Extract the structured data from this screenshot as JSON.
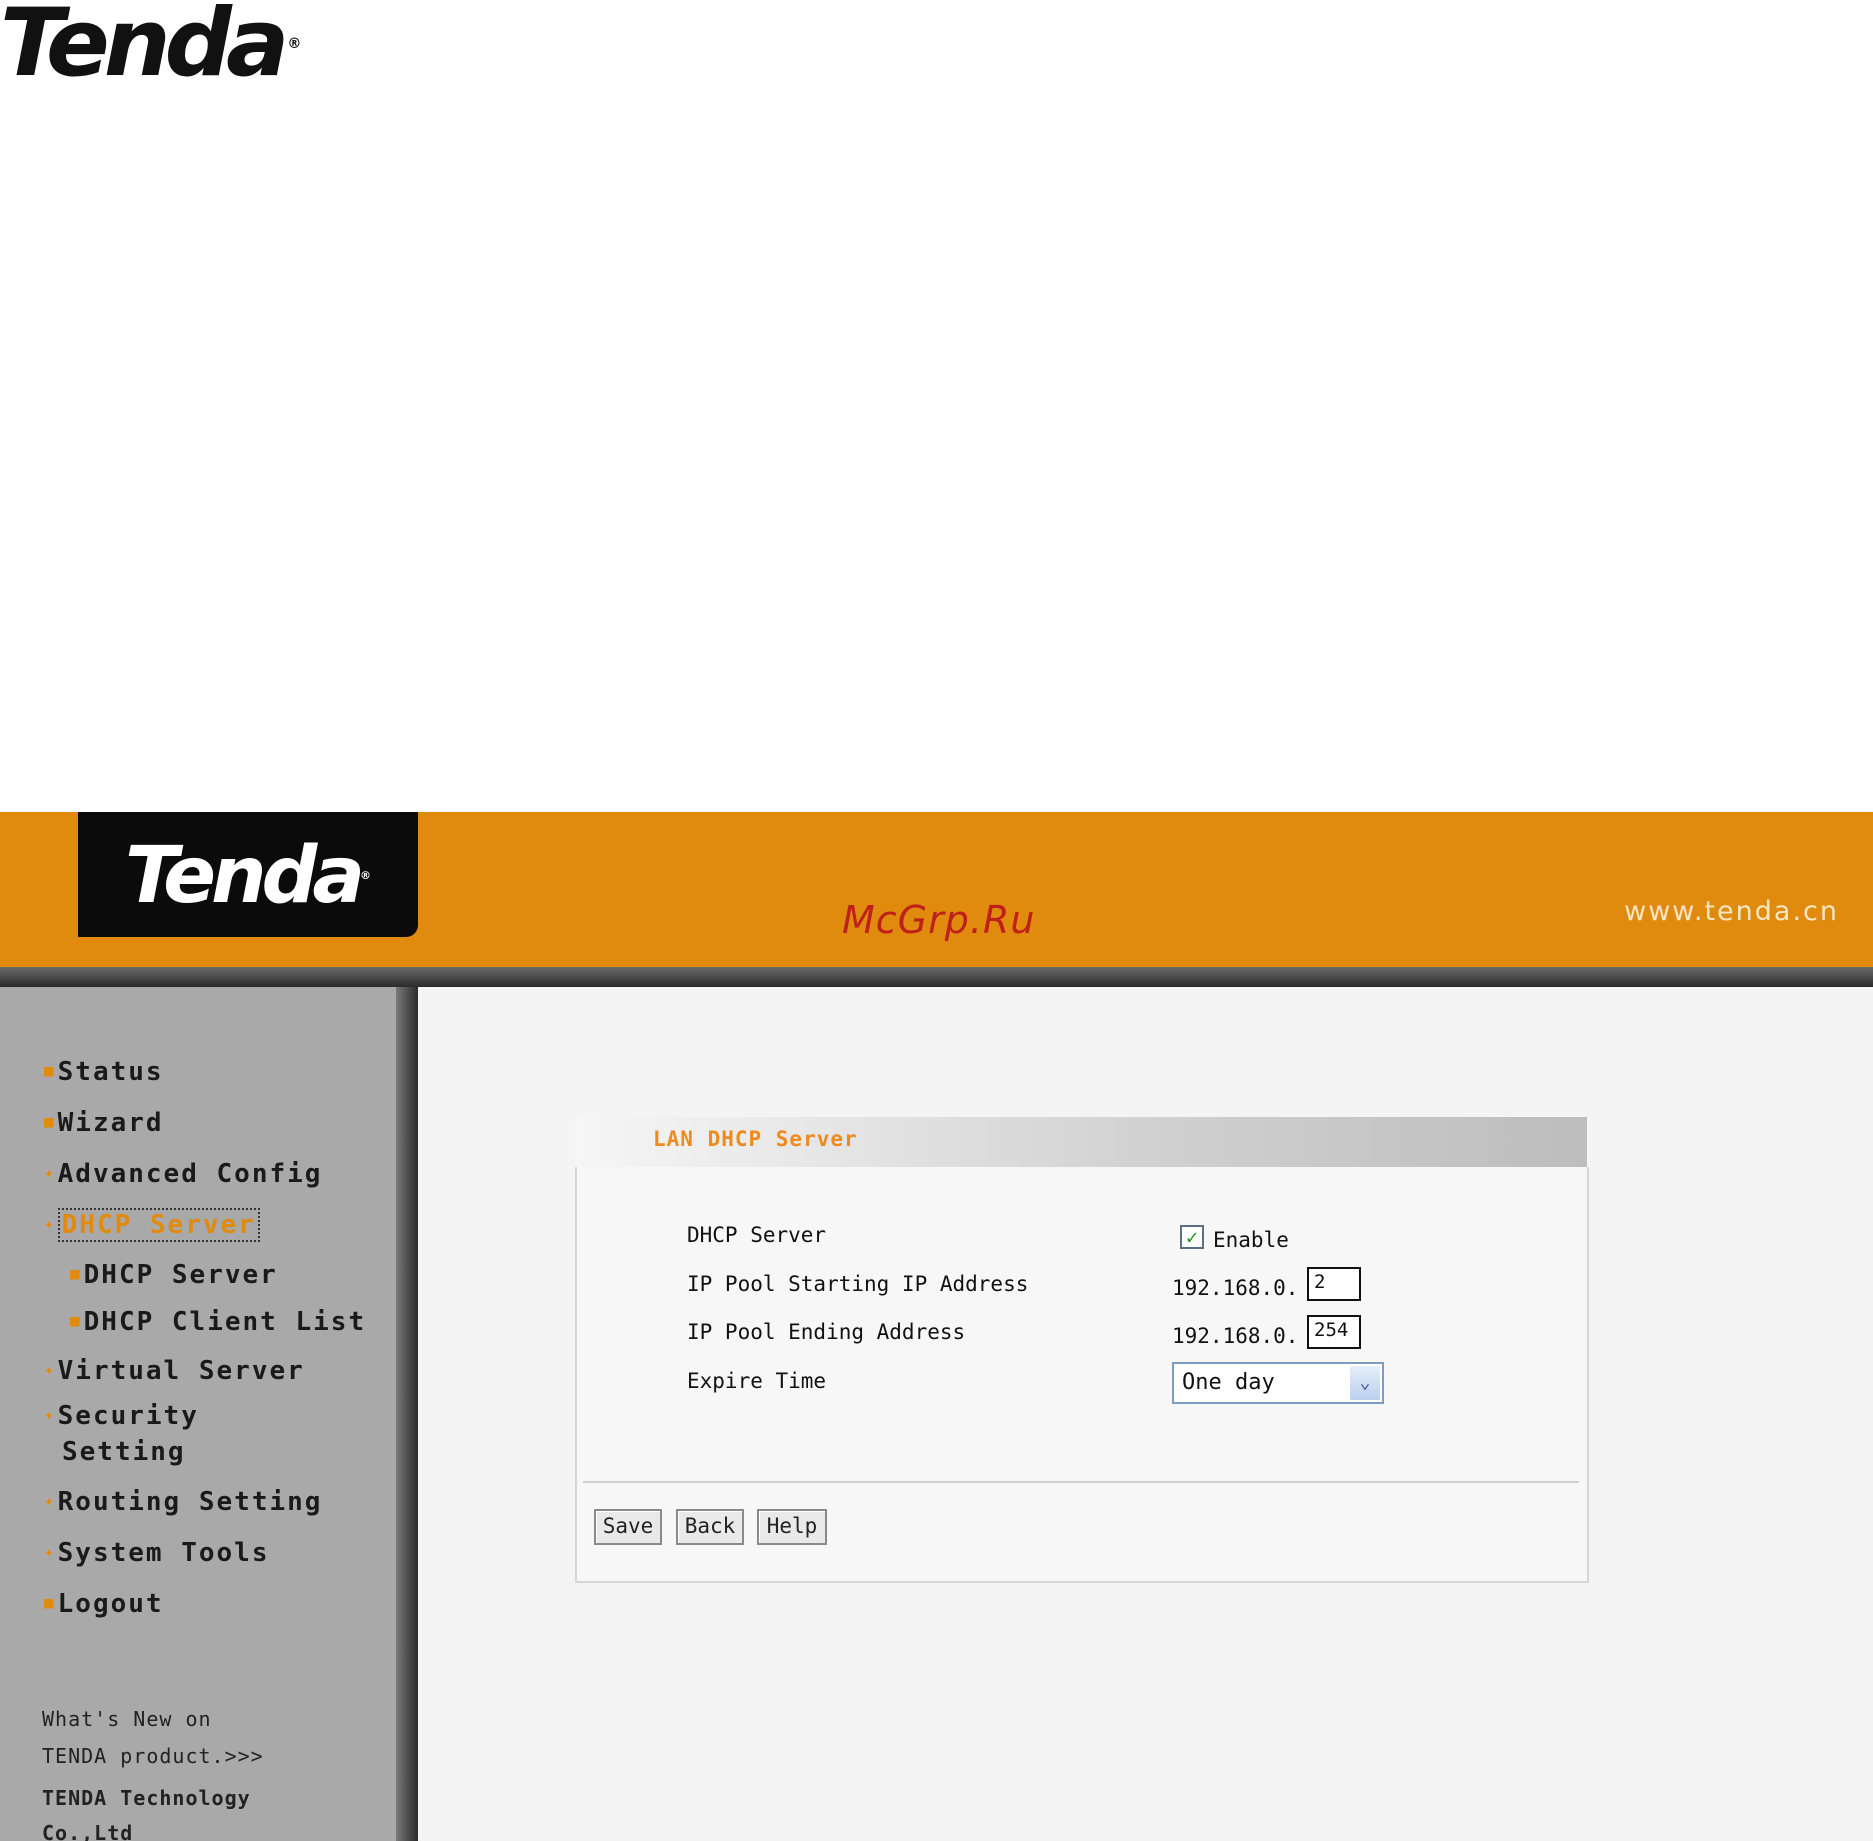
{
  "page": {
    "logo_text": "Tenda",
    "logo_mark": "®"
  },
  "header": {
    "logo_text": "Tenda",
    "logo_mark": "®",
    "watermark": "McGrp.Ru",
    "site_url": "www.tenda.cn",
    "accent_color": "#e08b0d"
  },
  "sidebar": {
    "items": [
      {
        "label": "Status"
      },
      {
        "label": "Wizard"
      },
      {
        "label": "Advanced Config"
      },
      {
        "label": "DHCP Server",
        "active": true
      },
      {
        "label": "DHCP Server",
        "sub": true
      },
      {
        "label": "DHCP Client List",
        "sub": true
      },
      {
        "label": "Virtual Server"
      },
      {
        "label_line1": "Security",
        "label_line2": "Setting"
      },
      {
        "label": "Routing Setting"
      },
      {
        "label": "System Tools"
      },
      {
        "label": "Logout"
      }
    ],
    "note_line1": "What's New on",
    "note_line2": "TENDA product.>>>",
    "company_line1": "TENDA Technology",
    "company_line2": "Co.,Ltd"
  },
  "panel": {
    "title": "LAN DHCP Server",
    "fields": {
      "dhcp_server": {
        "label": "DHCP Server",
        "checked": true,
        "check_label": "Enable"
      },
      "start_ip": {
        "label": "IP Pool Starting IP Address",
        "prefix": "192.168.0.",
        "value": "2"
      },
      "end_ip": {
        "label": "IP Pool Ending Address",
        "prefix": "192.168.0.",
        "value": "254"
      },
      "expire": {
        "label": "Expire Time",
        "value": "One day"
      }
    },
    "buttons": {
      "save": "Save",
      "back": "Back",
      "help": "Help"
    }
  }
}
